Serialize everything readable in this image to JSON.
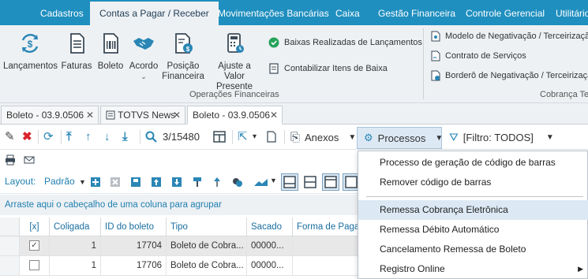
{
  "menubar": {
    "items": [
      "Cadastros",
      "Contas a Pagar / Receber",
      "Movimentações Bancárias",
      "Caixa",
      "Gestão Financeira",
      "Controle Gerencial",
      "Utilitários"
    ],
    "bg": "#1f8fbf"
  },
  "ribbon": {
    "buttons": [
      {
        "label": "Lançamentos",
        "icon": "dollar-cycle-icon"
      },
      {
        "label": "Faturas",
        "icon": "invoice-icon"
      },
      {
        "label": "Boleto",
        "icon": "barcode-document-icon"
      },
      {
        "label": "Acordo",
        "icon": "handshake-icon"
      },
      {
        "label": "Posição\nFinanceira",
        "icon": "finance-position-icon"
      },
      {
        "label": "Ajuste a Valor\nPresente",
        "icon": "calculator-icon"
      }
    ],
    "small_items": [
      {
        "label": "Baixas Realizadas de Lançamentos",
        "icon": "check-circle-icon"
      },
      {
        "label": "Contabilizar Itens de Baixa",
        "icon": "ledger-icon"
      }
    ],
    "group1_label": "Operações Financeiras",
    "right_items": [
      {
        "label": "Modelo de Negativação / Terceirização",
        "icon": "model-doc-icon"
      },
      {
        "label": "Contrato de Serviços",
        "icon": "contract-icon"
      },
      {
        "label": "Borderô de Negativação / Terceirização",
        "icon": "bordero-icon"
      }
    ],
    "group2_label": "Cobrança Te"
  },
  "doc_tabs": [
    {
      "label": "Boleto - 03.9.0506",
      "active": false
    },
    {
      "label": "TOTVS News",
      "active": false
    },
    {
      "label": "Boleto - 03.9.0506",
      "active": true
    }
  ],
  "toolbar": {
    "record_counter": "3/15480",
    "anexos_label": "Anexos",
    "processos_label": "Processos",
    "filter_label": "[Filtro: TODOS]"
  },
  "layout_bar": {
    "label": "Layout:",
    "layout_value": "Padrão"
  },
  "group_hint": "Arraste aqui o cabeçalho de uma coluna para agrupar",
  "grid": {
    "headers": [
      "[x]",
      "Coligada",
      "ID do boleto",
      "Tipo",
      "Sacado",
      "Forma de Pagam"
    ],
    "rows": [
      {
        "checked": true,
        "coligada": "1",
        "id": "17704",
        "tipo": "Boleto de Cobra...",
        "sacado": "00000..."
      },
      {
        "checked": false,
        "coligada": "1",
        "id": "17706",
        "tipo": "Boleto de Cobra...",
        "sacado": "00000..."
      }
    ]
  },
  "processos_menu": {
    "items": [
      {
        "label": "Processo de geração de código de barras",
        "highlight": false
      },
      {
        "label": "Remover código de barras",
        "highlight": false
      },
      {
        "label": "Remessa Cobrança Eletrônica",
        "highlight": true
      },
      {
        "label": "Remessa Débito Automático",
        "highlight": false
      },
      {
        "label": "Cancelamento Remessa de Boleto",
        "highlight": false
      },
      {
        "label": "Registro Online",
        "highlight": false
      }
    ]
  },
  "colors": {
    "accent": "#1f8fbf",
    "highlight": "#dce9f4",
    "danger": "#d9232d"
  }
}
